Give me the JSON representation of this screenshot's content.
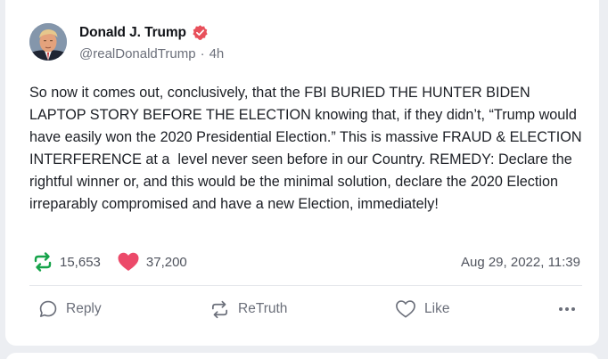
{
  "post": {
    "author": {
      "display_name": "Donald J. Trump",
      "verified": true,
      "handle": "@realDonaldTrump",
      "separator": "·",
      "age": "4h",
      "avatar_icon": "profile-photo"
    },
    "body": "So now it comes out, conclusively, that the FBI BURIED THE HUNTER BIDEN LAPTOP STORY BEFORE THE ELECTION knowing that, if they didn’t, “Trump would have easily won the 2020 Presidential Election.” This is massive FRAUD & ELECTION INTERFERENCE at a  level never seen before in our Country. REMEDY: Declare the rightful winner or, and this would be the minimal solution, declare the 2020 Election irreparably compromised and have a new Election, immediately!",
    "stats": {
      "retruths": "15,653",
      "likes": "37,200",
      "timestamp": "Aug 29, 2022, 11:39"
    },
    "actions": {
      "reply_label": "Reply",
      "retruth_label": "ReTruth",
      "like_label": "Like",
      "more_icon": "more-horizontal-icon"
    }
  },
  "colors": {
    "verified_badge": "#e8505b",
    "retruth_green": "#16a34a",
    "like_pink": "#ec4a6a",
    "secondary_text": "#6b6f7a",
    "background": "#eceef2",
    "card": "#ffffff"
  }
}
